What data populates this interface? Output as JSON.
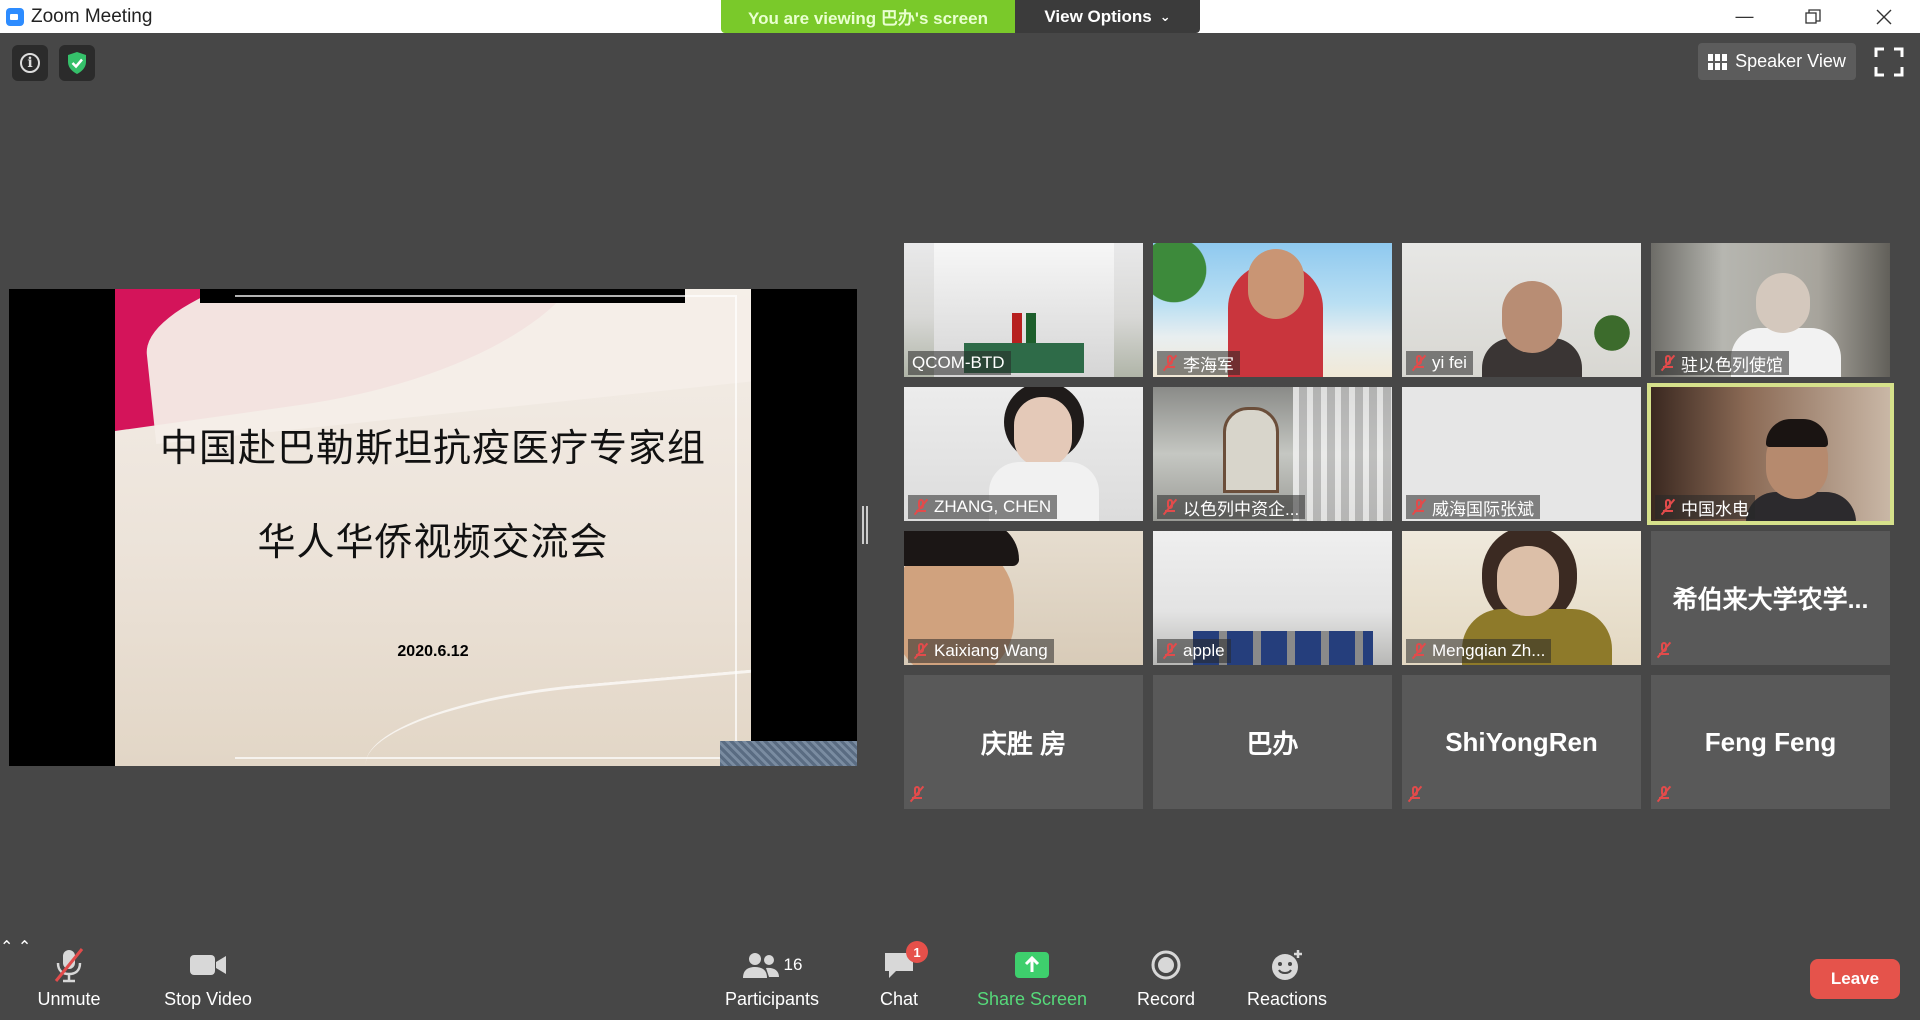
{
  "window": {
    "title": "Zoom Meeting",
    "minimize_icon": "minimize-icon",
    "restore_icon": "restore-icon",
    "close_icon": "close-icon"
  },
  "banner": {
    "viewing_text": "You are viewing 巴办's screen",
    "view_options_label": "View Options"
  },
  "top_controls": {
    "info_icon": "info-icon",
    "security_icon": "shield-check-icon",
    "speaker_view_label": "Speaker View",
    "fullscreen_icon": "fullscreen-icon"
  },
  "shared_screen": {
    "slide_line1": "中国赴巴勒斯坦抗疫医疗专家组",
    "slide_line2": "华人华侨视频交流会",
    "slide_date": "2020.6.12",
    "accent_color": "#d4145a"
  },
  "participants_grid": [
    {
      "name": "QCOM-BTD",
      "muted": false,
      "video": true
    },
    {
      "name": "李海军",
      "muted": true,
      "video": true
    },
    {
      "name": "yi fei",
      "muted": true,
      "video": true
    },
    {
      "name": "驻以色列使馆",
      "muted": true,
      "video": true
    },
    {
      "name": "ZHANG, CHEN",
      "muted": true,
      "video": true
    },
    {
      "name": "以色列中资企...",
      "muted": true,
      "video": true
    },
    {
      "name": "威海国际张斌",
      "muted": true,
      "video": true
    },
    {
      "name": "中国水电",
      "muted": true,
      "video": true,
      "active_speaker": true
    },
    {
      "name": "Kaixiang Wang",
      "muted": true,
      "video": true
    },
    {
      "name": "apple",
      "muted": true,
      "video": true
    },
    {
      "name": "Mengqian Zh...",
      "muted": true,
      "video": true
    },
    {
      "name": "希伯来大学农学...",
      "muted": true,
      "video": false
    },
    {
      "name": "庆胜 房",
      "muted": true,
      "video": false
    },
    {
      "name": "巴办",
      "muted": false,
      "video": false
    },
    {
      "name": "ShiYongRen",
      "muted": true,
      "video": false
    },
    {
      "name": "Feng Feng",
      "muted": true,
      "video": false
    }
  ],
  "toolbar": {
    "unmute_label": "Unmute",
    "stop_video_label": "Stop Video",
    "participants_label": "Participants",
    "participants_count": "16",
    "chat_label": "Chat",
    "chat_badge": "1",
    "share_screen_label": "Share Screen",
    "record_label": "Record",
    "reactions_label": "Reactions",
    "leave_label": "Leave",
    "share_color": "#56d97a",
    "leave_color": "#e5534b"
  }
}
